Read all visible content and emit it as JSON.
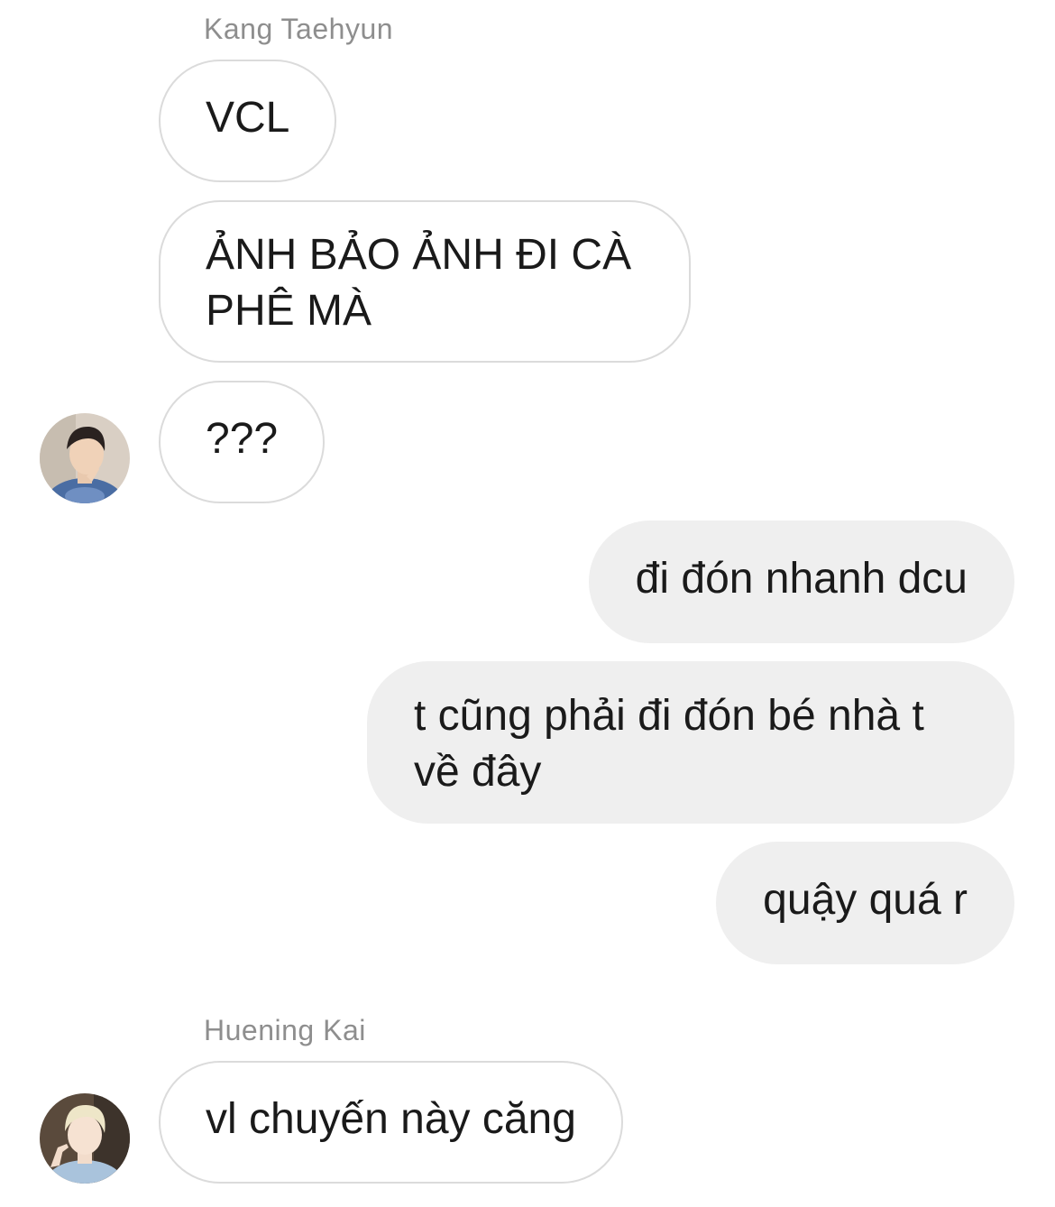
{
  "conversation": {
    "groups": [
      {
        "sender": "Kang Taehyun",
        "messages": [
          {
            "text": "VCL"
          },
          {
            "text": "ẢNH BẢO ẢNH ĐI CÀ PHÊ MÀ"
          },
          {
            "text": "???"
          }
        ]
      },
      {
        "sender": "",
        "messages": [
          {
            "text": "đi đón nhanh dcu"
          },
          {
            "text": "t cũng phải đi đón bé nhà t về đây"
          },
          {
            "text": "quậy quá r"
          }
        ]
      },
      {
        "sender": "Huening Kai",
        "messages": [
          {
            "text": "vl chuyến này căng"
          }
        ]
      }
    ]
  },
  "colors": {
    "incoming_bubble_bg": "#ffffff",
    "incoming_bubble_border": "#dbdbdb",
    "outgoing_bubble_bg": "#efefef",
    "sender_name": "#8e8e8e",
    "text": "#1a1a1a"
  },
  "icons": {
    "avatar_1": "profile-photo-avatar",
    "avatar_2": "profile-photo-avatar"
  }
}
